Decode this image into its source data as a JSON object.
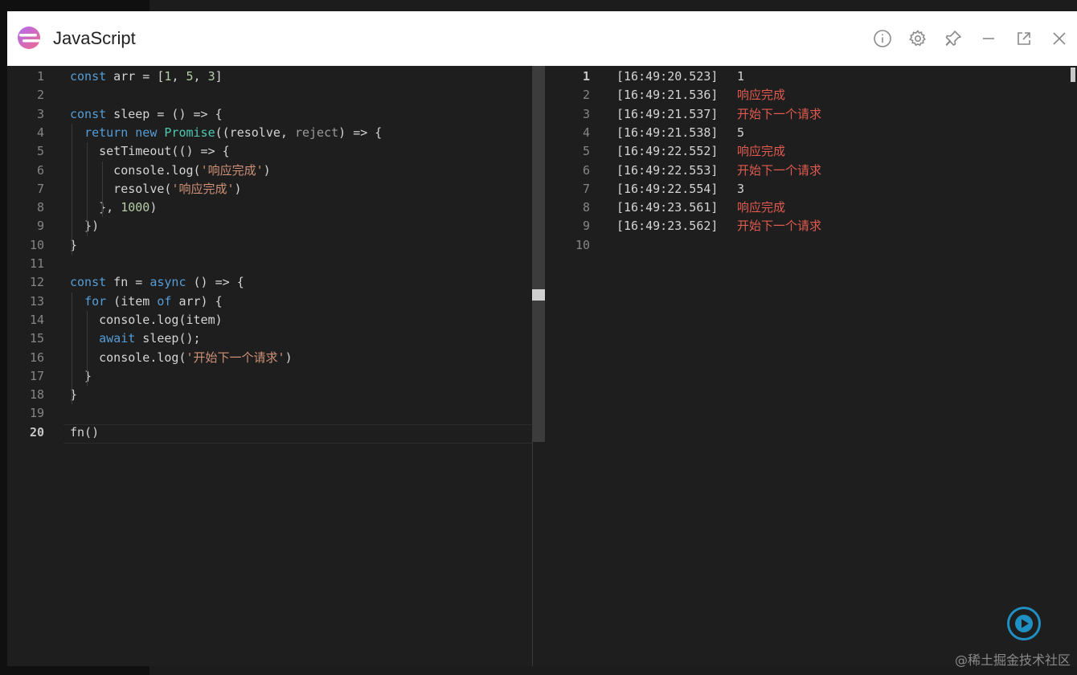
{
  "window": {
    "title": "JavaScript"
  },
  "titlebar_icons": [
    "info-icon",
    "gear-icon",
    "pin-icon",
    "minimize-icon",
    "popout-icon",
    "close-icon"
  ],
  "editor": {
    "active_line": 20,
    "lines": [
      {
        "n": "1"
      },
      {
        "n": "2"
      },
      {
        "n": "3"
      },
      {
        "n": "4"
      },
      {
        "n": "5"
      },
      {
        "n": "6"
      },
      {
        "n": "7"
      },
      {
        "n": "8"
      },
      {
        "n": "9"
      },
      {
        "n": "10"
      },
      {
        "n": "11"
      },
      {
        "n": "12"
      },
      {
        "n": "13"
      },
      {
        "n": "14"
      },
      {
        "n": "15"
      },
      {
        "n": "16"
      },
      {
        "n": "17"
      },
      {
        "n": "18"
      },
      {
        "n": "19"
      },
      {
        "n": "20"
      }
    ],
    "code": [
      [
        [
          "kw",
          "const"
        ],
        [
          "p",
          " arr = ["
        ],
        [
          "num",
          "1"
        ],
        [
          "p",
          ", "
        ],
        [
          "num",
          "5"
        ],
        [
          "p",
          ", "
        ],
        [
          "num",
          "3"
        ],
        [
          "p",
          "]"
        ]
      ],
      [],
      [
        [
          "kw",
          "const"
        ],
        [
          "p",
          " sleep = () => {"
        ]
      ],
      [
        [
          "p",
          "  "
        ],
        [
          "kw",
          "return"
        ],
        [
          "p",
          " "
        ],
        [
          "kw",
          "new"
        ],
        [
          "p",
          " "
        ],
        [
          "cls",
          "Promise"
        ],
        [
          "p",
          "((resolve, "
        ],
        [
          "par",
          "reject"
        ],
        [
          "p",
          ") => {"
        ]
      ],
      [
        [
          "p",
          "    setTimeout(() => {"
        ]
      ],
      [
        [
          "p",
          "      console.log("
        ],
        [
          "str",
          "'响应完成'"
        ],
        [
          "p",
          ")"
        ]
      ],
      [
        [
          "p",
          "      resolve("
        ],
        [
          "str",
          "'响应完成'"
        ],
        [
          "p",
          ")"
        ]
      ],
      [
        [
          "p",
          "    }, "
        ],
        [
          "num",
          "1000"
        ],
        [
          "p",
          ")"
        ]
      ],
      [
        [
          "p",
          "  })"
        ]
      ],
      [
        [
          "p",
          "}"
        ]
      ],
      [],
      [
        [
          "kw",
          "const"
        ],
        [
          "p",
          " fn = "
        ],
        [
          "kw",
          "async"
        ],
        [
          "p",
          " () => {"
        ]
      ],
      [
        [
          "p",
          "  "
        ],
        [
          "kw",
          "for"
        ],
        [
          "p",
          " (item "
        ],
        [
          "kw",
          "of"
        ],
        [
          "p",
          " arr) {"
        ]
      ],
      [
        [
          "p",
          "    console.log(item)"
        ]
      ],
      [
        [
          "p",
          "    "
        ],
        [
          "kw",
          "await"
        ],
        [
          "p",
          " sleep();"
        ]
      ],
      [
        [
          "p",
          "    console.log("
        ],
        [
          "str",
          "'开始下一个请求'"
        ],
        [
          "p",
          ")"
        ]
      ],
      [
        [
          "p",
          "  }"
        ]
      ],
      [
        [
          "p",
          "}"
        ]
      ],
      [],
      [
        [
          "p",
          "fn()"
        ]
      ]
    ]
  },
  "console": {
    "active_line": 1,
    "rows": [
      {
        "n": "1",
        "ts": "[16:49:20.523]",
        "val": "1",
        "kind": "num"
      },
      {
        "n": "2",
        "ts": "[16:49:21.536]",
        "val": "响应完成",
        "kind": "str"
      },
      {
        "n": "3",
        "ts": "[16:49:21.537]",
        "val": "开始下一个请求",
        "kind": "str"
      },
      {
        "n": "4",
        "ts": "[16:49:21.538]",
        "val": "5",
        "kind": "num"
      },
      {
        "n": "5",
        "ts": "[16:49:22.552]",
        "val": "响应完成",
        "kind": "str"
      },
      {
        "n": "6",
        "ts": "[16:49:22.553]",
        "val": "开始下一个请求",
        "kind": "str"
      },
      {
        "n": "7",
        "ts": "[16:49:22.554]",
        "val": "3",
        "kind": "num"
      },
      {
        "n": "8",
        "ts": "[16:49:23.561]",
        "val": "响应完成",
        "kind": "str"
      },
      {
        "n": "9",
        "ts": "[16:49:23.562]",
        "val": "开始下一个请求",
        "kind": "str"
      },
      {
        "n": "10",
        "ts": "",
        "val": "",
        "kind": "num"
      }
    ]
  },
  "run_button": {
    "icon": "play-icon"
  },
  "watermark": "@稀土掘金技术社区",
  "colors": {
    "keyword": "#569cd6",
    "string": "#ce9178",
    "number": "#b5cea8",
    "class": "#4ec9b0",
    "console_string": "#e05a4f",
    "run_button": "#1f8fc4"
  }
}
